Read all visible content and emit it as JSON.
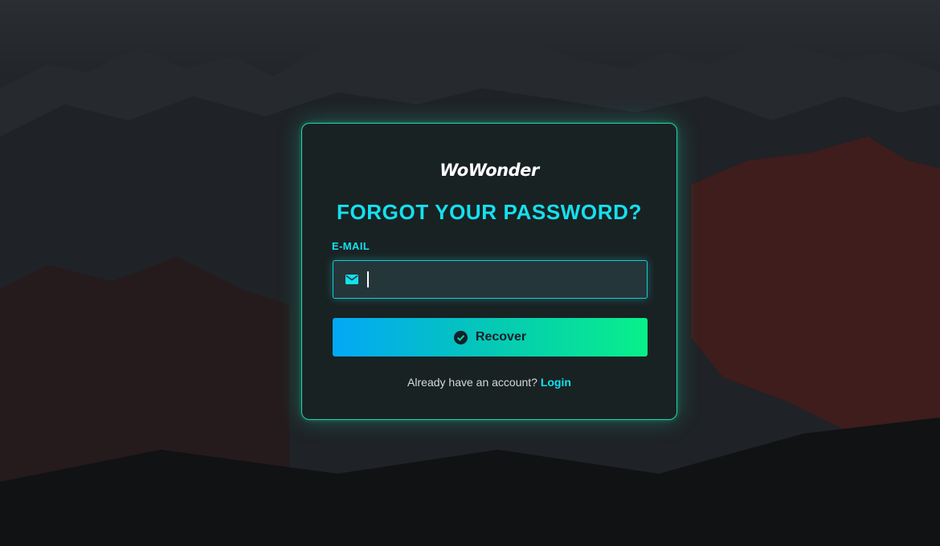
{
  "brand": {
    "logo_text": "WoWonder"
  },
  "form": {
    "title": "FORGOT YOUR PASSWORD?",
    "email_label": "E-MAIL",
    "email_value": "",
    "email_icon": "mail-icon",
    "submit_label": "Recover",
    "submit_icon": "check-circle-icon"
  },
  "footer": {
    "prompt": "Already have an account?",
    "login_link": "Login"
  },
  "colors": {
    "accent_cyan": "#14e0ef",
    "card_border": "#1fd6a8",
    "button_gradient_start": "#03a8f6",
    "button_gradient_end": "#08f08a",
    "background": "#1b1e22"
  }
}
